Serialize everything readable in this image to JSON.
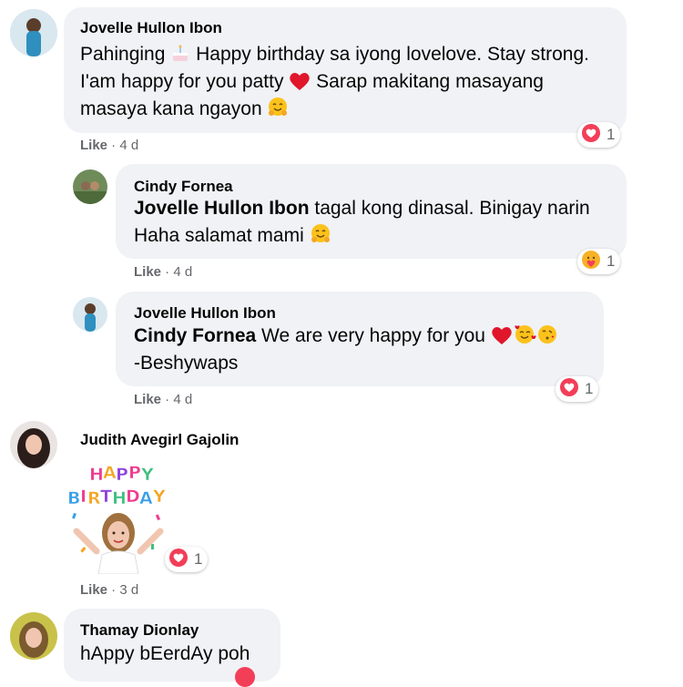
{
  "comments": [
    {
      "author": "Jovelle Hullon Ibon",
      "text_a": "Pahinging",
      "text_b": " Happy birthday sa iyong lovelove. Stay strong. I'am happy for you patty",
      "text_c": " Sarap makitang masayang masaya kana ngayon",
      "like": "Like",
      "time": "4 d",
      "reaction_icon": "love-reaction",
      "reaction_count": "1"
    },
    {
      "author": "Cindy Fornea",
      "mention": "Jovelle Hullon Ibon",
      "text": " tagal kong dinasal. Binigay narin Haha salamat mami",
      "like": "Like",
      "time": "4 d",
      "reaction_icon": "care-reaction",
      "reaction_count": "1"
    },
    {
      "author": "Jovelle Hullon Ibon",
      "mention": "Cindy Fornea",
      "text": " We are very happy for you",
      "text_line2": "-Beshywaps",
      "like": "Like",
      "time": "4 d",
      "reaction_icon": "love-reaction",
      "reaction_count": "1"
    },
    {
      "author": "Judith Avegirl Gajolin",
      "sticker_letters": "HAPPY BIRTHDAY",
      "like": "Like",
      "time": "3 d",
      "reaction_icon": "love-reaction",
      "reaction_count": "1"
    },
    {
      "author": "Thamay Dionlay",
      "text": "hAppy bEerdAy poh"
    }
  ],
  "meta_separator": " · ",
  "colors": {
    "bubble": "#f0f2f5",
    "meta": "#65676b",
    "love": "#f33e58",
    "care": "#f7b125"
  }
}
